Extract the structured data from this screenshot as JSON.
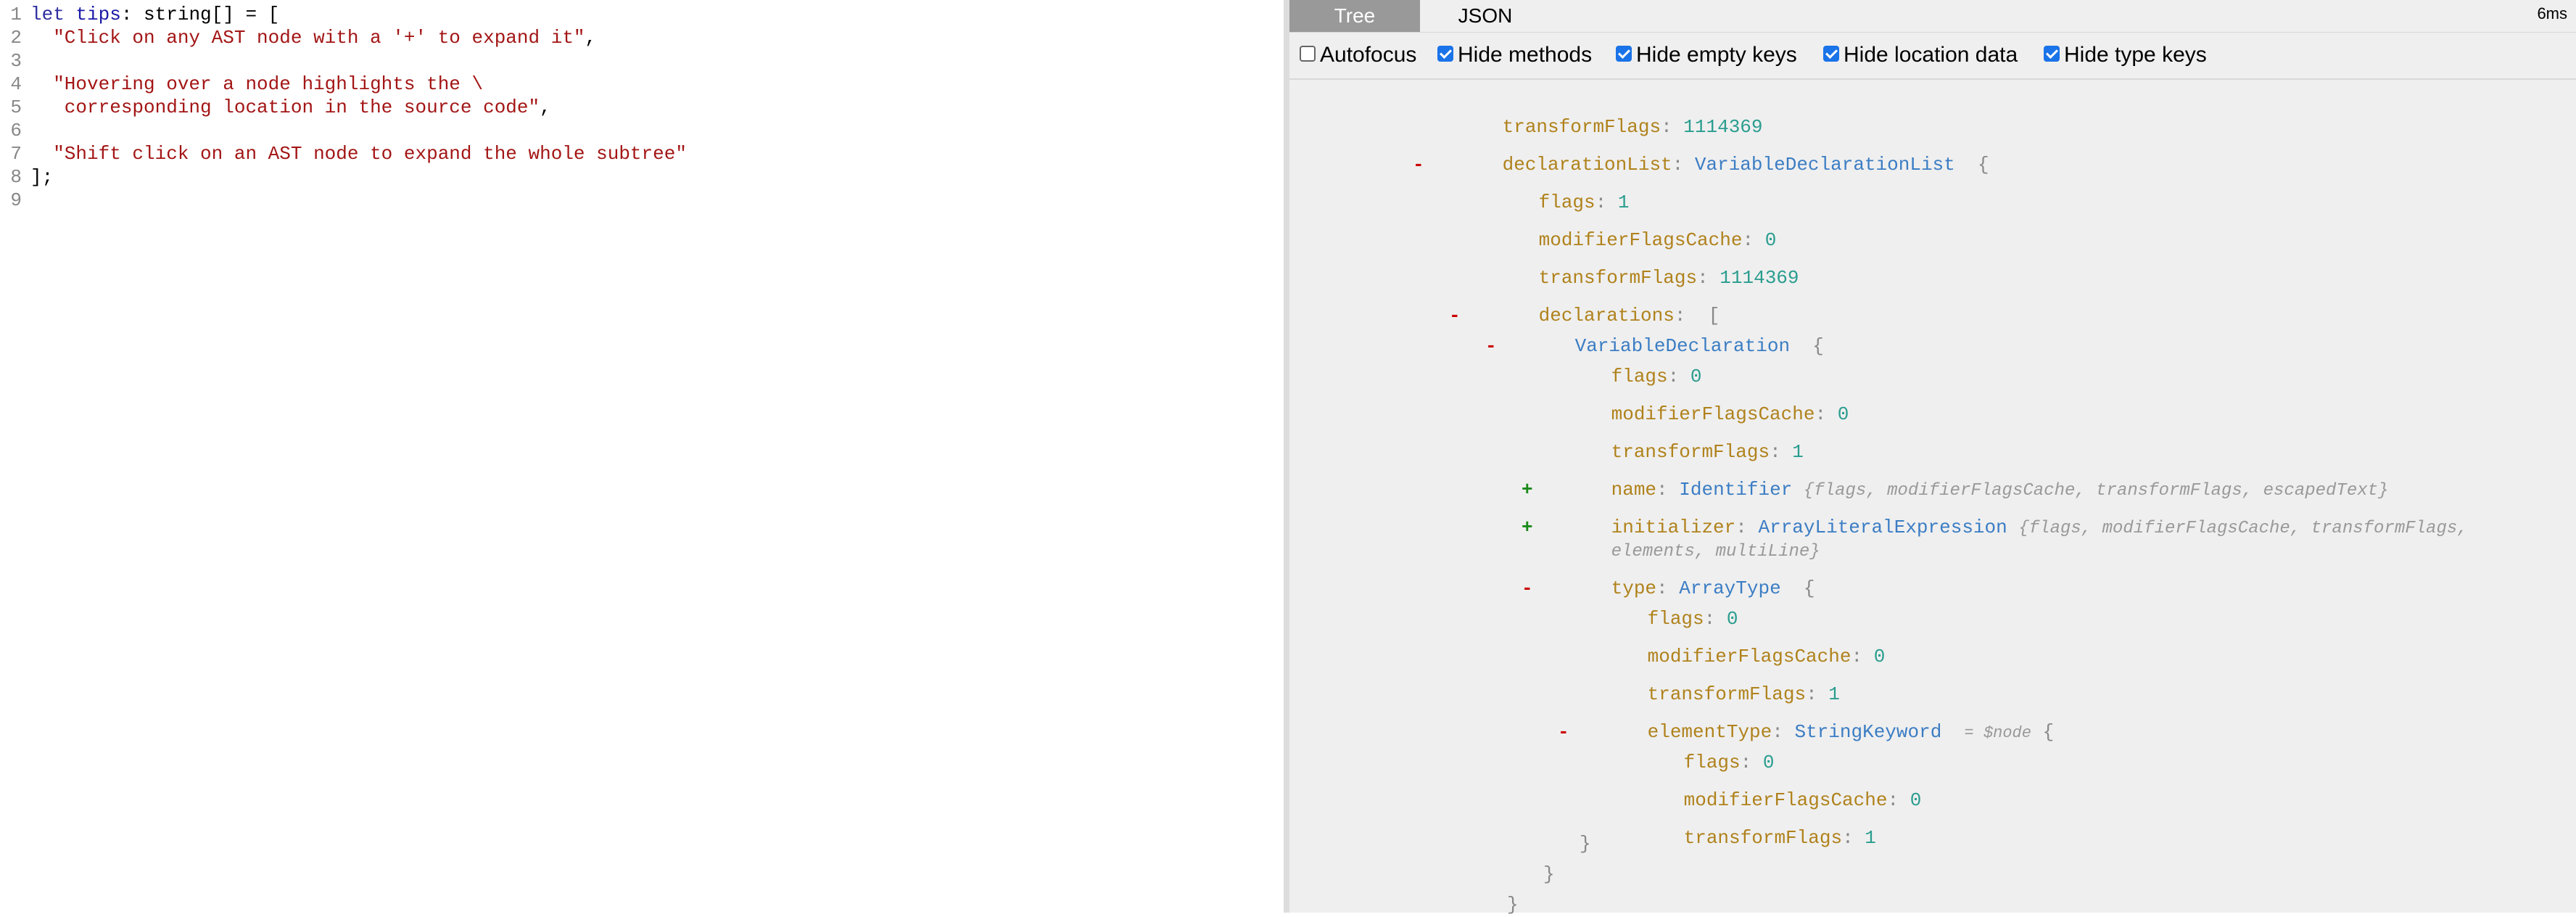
{
  "editor": {
    "lines": [
      {
        "num": "1",
        "parts": [
          [
            "keyword",
            "let "
          ],
          [
            "var",
            "tips"
          ],
          [
            "plain",
            ": string[] = ["
          ]
        ]
      },
      {
        "num": "2",
        "parts": [
          [
            "string",
            "  \"Click on any AST node with a '+' to expand it\""
          ],
          [
            "plain",
            ","
          ]
        ]
      },
      {
        "num": "3",
        "parts": []
      },
      {
        "num": "4",
        "parts": [
          [
            "string",
            "  \"Hovering over a node highlights the \\"
          ]
        ]
      },
      {
        "num": "5",
        "parts": [
          [
            "string",
            "   corresponding location in the source code\""
          ],
          [
            "plain",
            ","
          ]
        ]
      },
      {
        "num": "6",
        "parts": []
      },
      {
        "num": "7",
        "parts": [
          [
            "string",
            "  \"Shift click on an AST node to expand the whole subtree\""
          ]
        ]
      },
      {
        "num": "8",
        "parts": [
          [
            "plain",
            "];"
          ]
        ]
      },
      {
        "num": "9",
        "parts": []
      }
    ]
  },
  "output": {
    "tabs": {
      "tree": "Tree",
      "json": "JSON"
    },
    "timing": "6ms",
    "options": [
      {
        "label": "Autofocus",
        "checked": false
      },
      {
        "label": "Hide methods",
        "checked": true
      },
      {
        "label": "Hide empty keys",
        "checked": true
      },
      {
        "label": "Hide location data",
        "checked": true
      },
      {
        "label": "Hide type keys",
        "checked": true
      }
    ]
  },
  "tree": {
    "root_transformFlags": {
      "key": "transformFlags",
      "value": "1114369"
    },
    "declarationList": {
      "key": "declarationList",
      "type": "VariableDeclarationList",
      "open": "{"
    },
    "dl_flags": {
      "key": "flags",
      "value": "1"
    },
    "dl_modifierFlagsCache": {
      "key": "modifierFlagsCache",
      "value": "0"
    },
    "dl_transformFlags": {
      "key": "transformFlags",
      "value": "1114369"
    },
    "declarations": {
      "key": "declarations",
      "open": "["
    },
    "vd": {
      "type": "VariableDeclaration",
      "open": "{"
    },
    "vd_flags": {
      "key": "flags",
      "value": "0"
    },
    "vd_modifierFlagsCache": {
      "key": "modifierFlagsCache",
      "value": "0"
    },
    "vd_transformFlags": {
      "key": "transformFlags",
      "value": "1"
    },
    "name": {
      "key": "name",
      "type": "Identifier",
      "summary": "{flags, modifierFlagsCache, transformFlags, escapedText}"
    },
    "initializer": {
      "key": "initializer",
      "type": "ArrayLiteralExpression",
      "summary1": "{flags, modifierFlagsCache, transformFlags,",
      "summary2": "elements, multiLine}"
    },
    "typeNode": {
      "key": "type",
      "type": "ArrayType",
      "open": "{"
    },
    "at_flags": {
      "key": "flags",
      "value": "0"
    },
    "at_modifierFlagsCache": {
      "key": "modifierFlagsCache",
      "value": "0"
    },
    "at_transformFlags": {
      "key": "transformFlags",
      "value": "1"
    },
    "elementType": {
      "key": "elementType",
      "type": "StringKeyword",
      "note": "= $node",
      "open": "{"
    },
    "sk_flags": {
      "key": "flags",
      "value": "0"
    },
    "sk_modifierFlagsCache": {
      "key": "modifierFlagsCache",
      "value": "0"
    },
    "sk_transformFlags": {
      "key": "transformFlags",
      "value": "1"
    },
    "close_sk": "}",
    "close_at": "}",
    "close_vd": "}"
  }
}
